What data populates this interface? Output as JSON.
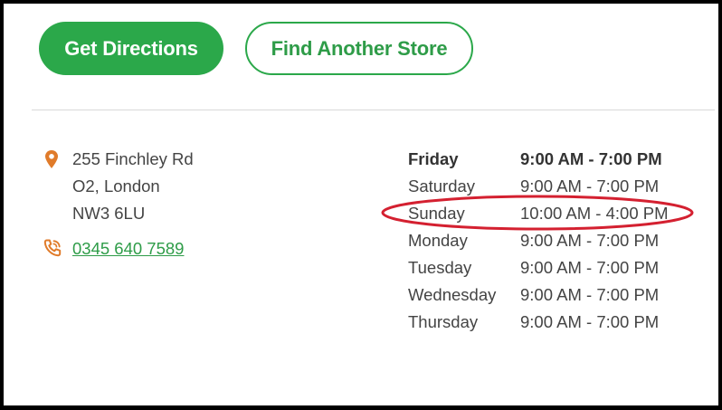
{
  "actions": {
    "directions_label": "Get Directions",
    "find_store_label": "Find Another Store"
  },
  "address": {
    "line1": "255 Finchley Rd",
    "line2": "O2, London",
    "line3": "NW3 6LU",
    "phone": "0345 640 7589"
  },
  "hours": [
    {
      "day": "Friday",
      "time": "9:00 AM - 7:00 PM",
      "today": true
    },
    {
      "day": "Saturday",
      "time": "9:00 AM - 7:00 PM",
      "today": false
    },
    {
      "day": "Sunday",
      "time": "10:00 AM - 4:00 PM",
      "today": false,
      "highlighted": true
    },
    {
      "day": "Monday",
      "time": "9:00 AM - 7:00 PM",
      "today": false
    },
    {
      "day": "Tuesday",
      "time": "9:00 AM - 7:00 PM",
      "today": false
    },
    {
      "day": "Wednesday",
      "time": "9:00 AM - 7:00 PM",
      "today": false
    },
    {
      "day": "Thursday",
      "time": "9:00 AM - 7:00 PM",
      "today": false
    }
  ],
  "icons": {
    "address": "map-pin-icon",
    "phone": "phone-ringing-icon"
  },
  "colors": {
    "brand_green": "#2ba84a",
    "link_green": "#2e9c48",
    "icon_orange": "#e07b2a",
    "annotation_red": "#d42030",
    "text": "#444444"
  }
}
